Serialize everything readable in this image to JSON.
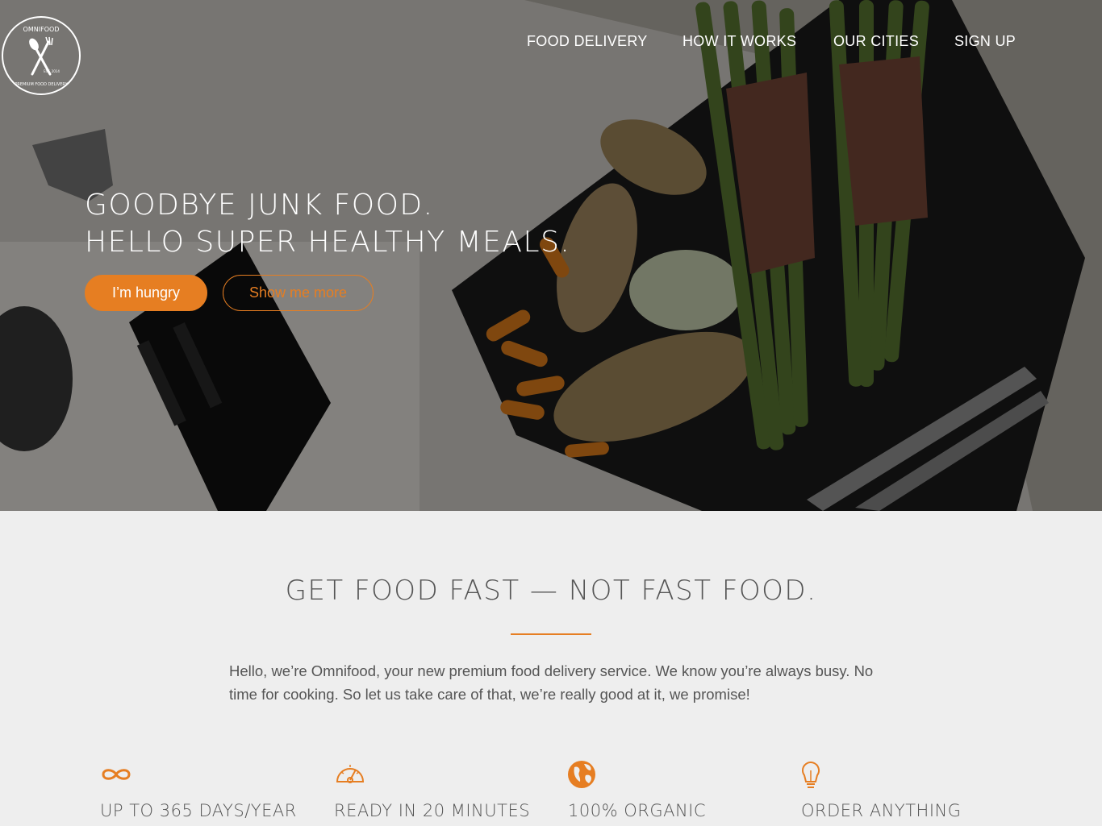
{
  "brand": {
    "logo_text": "OMNIFOOD",
    "logo_subtext": "PREMIUM FOOD DELIVERY",
    "logo_est": "EST. 2014",
    "accent_color": "#e67e22"
  },
  "nav": {
    "items": [
      {
        "label": "FOOD DELIVERY"
      },
      {
        "label": "HOW IT WORKS"
      },
      {
        "label": "OUR CITIES"
      },
      {
        "label": "SIGN UP"
      }
    ]
  },
  "hero": {
    "headline_line1": "GOODBYE JUNK FOOD.",
    "headline_line2": "HELLO SUPER HEALTHY MEALS.",
    "primary_button": "I’m hungry",
    "secondary_button": "Show me more"
  },
  "features": {
    "title": "GET FOOD FAST — NOT FAST FOOD.",
    "intro": "Hello, we’re Omnifood, your new premium food delivery service. We know you’re always busy. No time for cooking. So let us take care of that, we’re really good at it, we promise!",
    "items": [
      {
        "icon": "infinity-icon",
        "label": "UP TO 365 DAYS/YEAR"
      },
      {
        "icon": "speedometer-icon",
        "label": "READY IN 20 MINUTES"
      },
      {
        "icon": "globe-icon",
        "label": "100% ORGANIC"
      },
      {
        "icon": "lightbulb-icon",
        "label": "ORDER ANYTHING"
      }
    ]
  }
}
